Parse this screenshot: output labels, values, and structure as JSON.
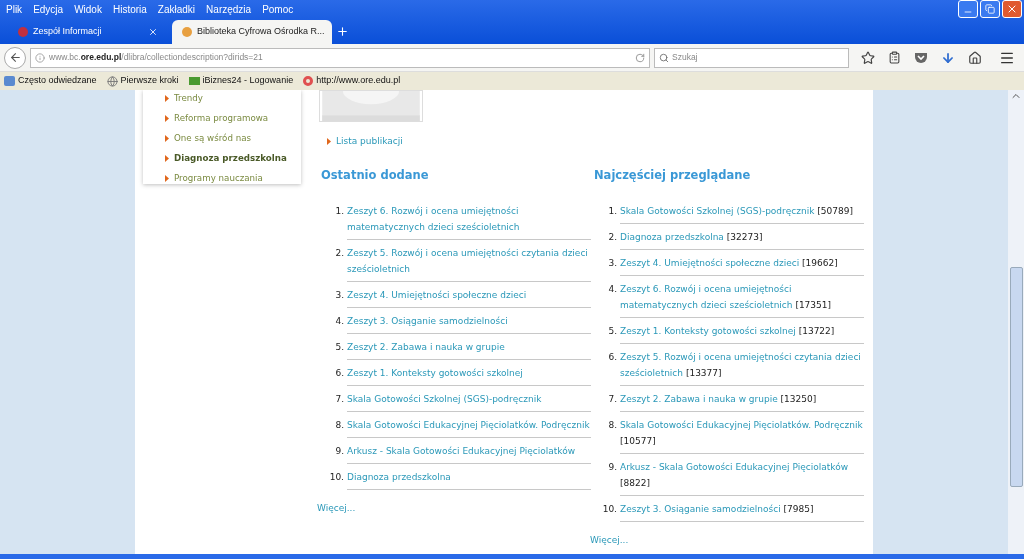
{
  "menu": [
    "Plik",
    "Edycja",
    "Widok",
    "Historia",
    "Zakładki",
    "Narzędzia",
    "Pomoc"
  ],
  "tabs": [
    {
      "title": "Zespół Informacji",
      "selected": false
    },
    {
      "title": "Biblioteka Cyfrowa Ośrodka R...",
      "selected": true
    }
  ],
  "address": {
    "host_prefix": "www.bc.",
    "host": "ore.edu.pl",
    "path": "/dlibra/collectiondescription?dirids=21"
  },
  "search": {
    "placeholder": "Szukaj"
  },
  "bookmarks": [
    "Często odwiedzane",
    "Pierwsze kroki",
    "iBiznes24 - Logowanie",
    "http://www.ore.edu.pl"
  ],
  "sidebar": {
    "items": [
      {
        "label": "Trendy",
        "selected": false
      },
      {
        "label": "Reforma programowa",
        "selected": false
      },
      {
        "label": "One są wśród nas",
        "selected": false
      },
      {
        "label": "Diagnoza przedszkolna",
        "selected": true
      },
      {
        "label": "Programy nauczania",
        "selected": false
      }
    ]
  },
  "publications_link": "Lista publikacji",
  "recent": {
    "title": "Ostatnio dodane",
    "more": "Więcej...",
    "items": [
      {
        "number": "1.",
        "title": "Zeszyt 6. Rozwój i ocena umiejętności matematycznych dzieci sześcioletnich"
      },
      {
        "number": "2.",
        "title": "Zeszyt 5. Rozwój i ocena umiejętności czytania dzieci sześcioletnich"
      },
      {
        "number": "3.",
        "title": "Zeszyt 4. Umiejętności społeczne dzieci"
      },
      {
        "number": "4.",
        "title": "Zeszyt 3. Osiąganie samodzielności"
      },
      {
        "number": "5.",
        "title": "Zeszyt 2. Zabawa i nauka w grupie"
      },
      {
        "number": "6.",
        "title": "Zeszyt 1. Konteksty gotowości szkolnej"
      },
      {
        "number": "7.",
        "title": "Skala Gotowości Szkolnej (SGS)-podręcznik"
      },
      {
        "number": "8.",
        "title": "Skala Gotowości Edukacyjnej Pięciolatków. Podręcznik"
      },
      {
        "number": "9.",
        "title": "Arkusz - Skala Gotowości Edukacyjnej Pięciolatków"
      },
      {
        "number": "10.",
        "title": "Diagnoza przedszkolna"
      }
    ]
  },
  "popular": {
    "title": "Najczęściej przeglądane",
    "more": "Więcej...",
    "items": [
      {
        "number": "1.",
        "title": "Skala Gotowości Szkolnej (SGS)-podręcznik",
        "count": "[50789]"
      },
      {
        "number": "2.",
        "title": "Diagnoza przedszkolna",
        "count": "[32273]"
      },
      {
        "number": "3.",
        "title": "Zeszyt 4. Umiejętności społeczne dzieci",
        "count": "[19662]"
      },
      {
        "number": "4.",
        "title": "Zeszyt 6. Rozwój i ocena umiejętności matematycznych dzieci sześcioletnich",
        "count": "[17351]"
      },
      {
        "number": "5.",
        "title": "Zeszyt 1. Konteksty gotowości szkolnej",
        "count": "[13722]"
      },
      {
        "number": "6.",
        "title": "Zeszyt 5. Rozwój i ocena umiejętności czytania dzieci sześcioletnich",
        "count": "[13377]"
      },
      {
        "number": "7.",
        "title": "Zeszyt 2. Zabawa i nauka w grupie",
        "count": "[13250]"
      },
      {
        "number": "8.",
        "title": "Skala Gotowości Edukacyjnej Pięciolatków. Podręcznik",
        "count": "[10577]"
      },
      {
        "number": "9.",
        "title": "Arkusz - Skala Gotowości Edukacyjnej Pięciolatków",
        "count": "[8822]"
      },
      {
        "number": "10.",
        "title": "Zeszyt 3. Osiąganie samodzielności",
        "count": "[7985]"
      }
    ]
  }
}
